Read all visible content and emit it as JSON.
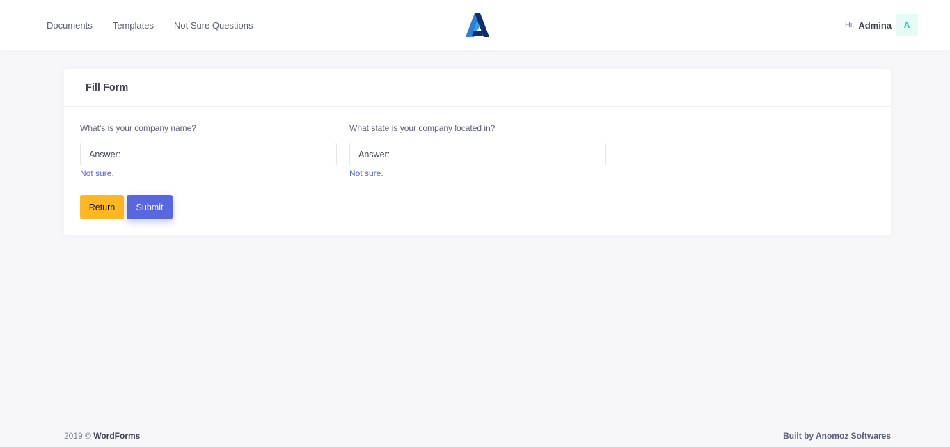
{
  "nav": {
    "items": [
      {
        "label": "Documents"
      },
      {
        "label": "Templates"
      },
      {
        "label": "Not Sure Questions"
      }
    ]
  },
  "logo": {
    "icon": "brand-logo-a-icon",
    "colors": [
      "#2b7fd4",
      "#0b2f6b"
    ]
  },
  "user": {
    "greeting": "Hi,",
    "name": "Admina",
    "avatar_letter": "A"
  },
  "card": {
    "title": "Fill Form",
    "fields": [
      {
        "label": "What's is your company name?",
        "value": "",
        "placeholder": "Answer:",
        "not_sure_label": "Not sure."
      },
      {
        "label": "What state is your company located in?",
        "value": "",
        "placeholder": "Answer:",
        "not_sure_label": "Not sure."
      }
    ],
    "buttons": {
      "return_label": "Return",
      "submit_label": "Submit"
    }
  },
  "footer": {
    "year_copy": "2019 ©",
    "brand": "WordForms",
    "built_by": "Built by Anomoz Softwares"
  },
  "colors": {
    "background": "#f7f7fa",
    "primary": "#5867dd",
    "warning": "#ffb822",
    "avatar_bg": "#e6faf6",
    "avatar_text": "#1bc5bd"
  }
}
